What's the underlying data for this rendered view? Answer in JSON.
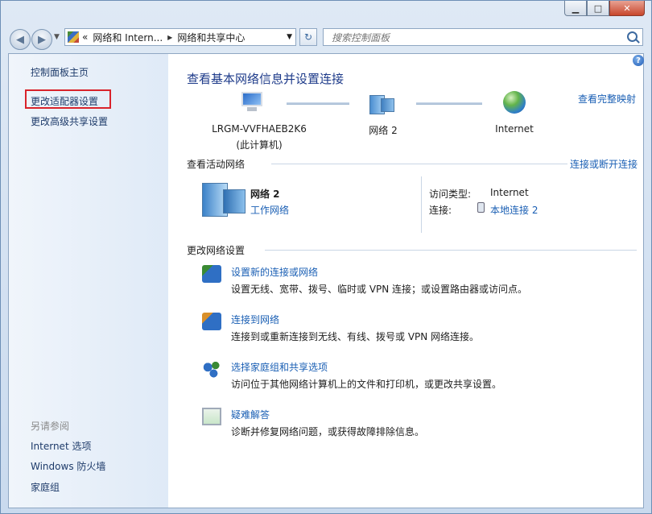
{
  "window": {
    "caption_buttons": {
      "minimize": "▁",
      "maximize": "□",
      "close": "✕"
    }
  },
  "address_bar": {
    "overflow": "«",
    "crumbs": [
      "网络和 Intern...",
      "网络和共享中心"
    ],
    "search_placeholder": "搜索控制面板"
  },
  "sidebar": {
    "home": "控制面板主页",
    "links": [
      "更改适配器设置",
      "更改高级共享设置"
    ],
    "see_also_label": "另请参阅",
    "see_also": [
      "Internet 选项",
      "Windows 防火墙",
      "家庭组"
    ]
  },
  "main": {
    "title": "查看基本网络信息并设置连接",
    "full_map_link": "查看完整映射",
    "map": {
      "computer_name": "LRGM-VVFHAEB2K6",
      "computer_sub": "(此计算机)",
      "network_name": "网络  2",
      "internet": "Internet"
    },
    "active_header": "查看活动网络",
    "connect_link": "连接或断开连接",
    "active": {
      "name": "网络  2",
      "type_link": "工作网络",
      "access_label": "访问类型:",
      "access_value": "Internet",
      "conn_label": "连接:",
      "conn_value": "本地连接 2"
    },
    "change_header": "更改网络设置",
    "tasks": [
      {
        "title": "设置新的连接或网络",
        "desc": "设置无线、宽带、拨号、临时或 VPN 连接；或设置路由器或访问点。"
      },
      {
        "title": "连接到网络",
        "desc": "连接到或重新连接到无线、有线、拨号或 VPN 网络连接。"
      },
      {
        "title": "选择家庭组和共享选项",
        "desc": "访问位于其他网络计算机上的文件和打印机，或更改共享设置。"
      },
      {
        "title": "疑难解答",
        "desc": "诊断并修复网络问题，或获得故障排除信息。"
      }
    ]
  },
  "colors": {
    "link": "#1a5fb4",
    "title": "#1e3b8a",
    "highlight_box": "#d9232b"
  }
}
